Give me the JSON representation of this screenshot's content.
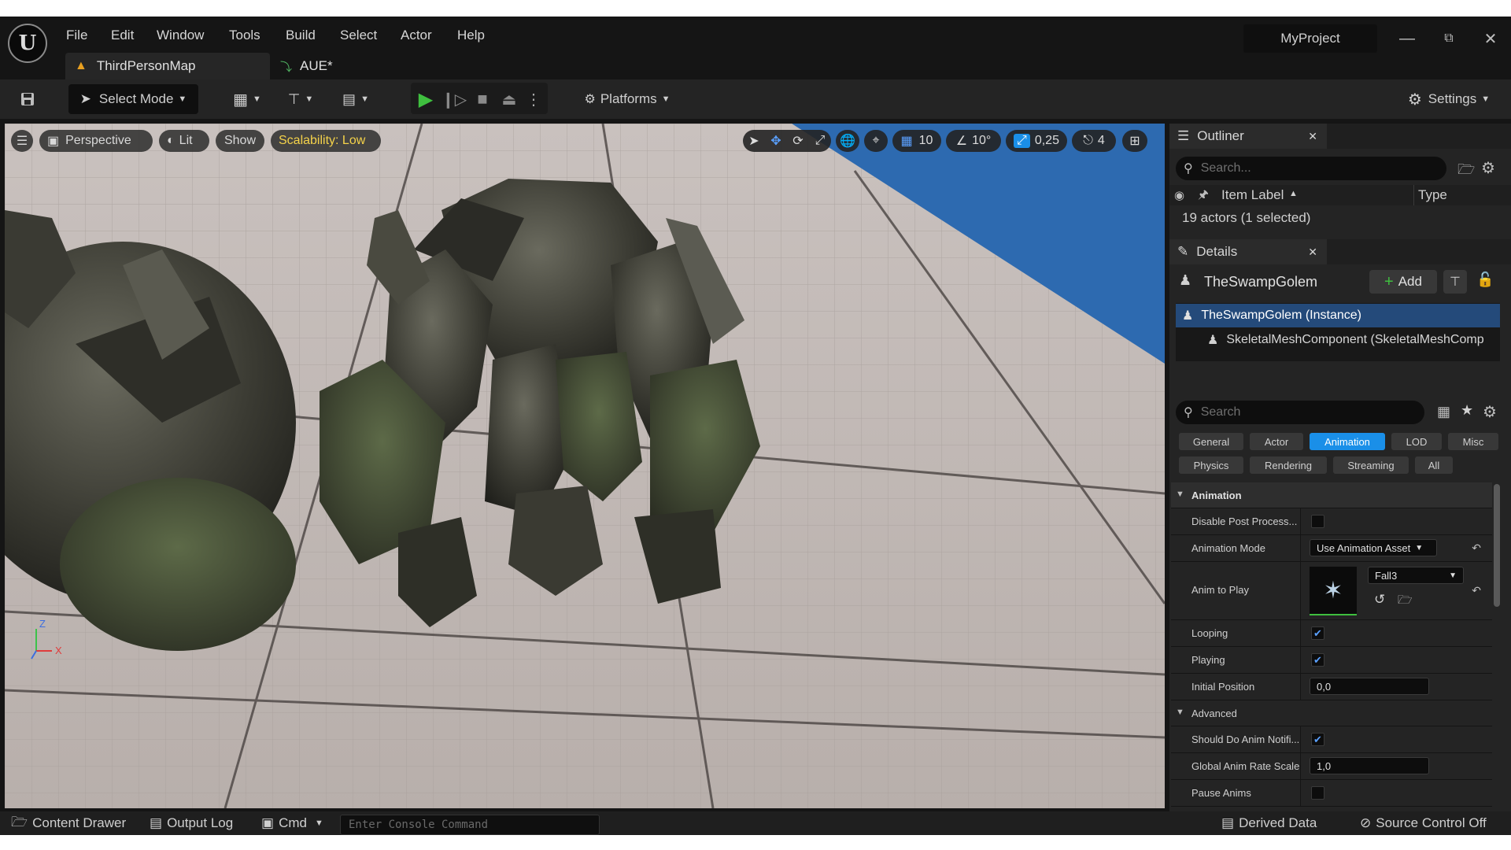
{
  "app": {
    "project": "MyProject"
  },
  "menu": [
    "File",
    "Edit",
    "Window",
    "Tools",
    "Build",
    "Select",
    "Actor",
    "Help"
  ],
  "tabs": {
    "map": "ThirdPersonMap",
    "asset": "AUE*"
  },
  "toolbar": {
    "select_mode": "Select Mode",
    "platforms": "Platforms",
    "settings": "Settings"
  },
  "viewport": {
    "perspective": "Perspective",
    "lit": "Lit",
    "show": "Show",
    "scalability": "Scalability: Low",
    "grid_snap": "10",
    "rotation_snap": "10°",
    "scale_snap": "0,25",
    "camera_speed": "4",
    "axis": {
      "z": "Z",
      "x": "X"
    }
  },
  "outliner": {
    "title": "Outliner",
    "search_placeholder": "Search...",
    "col_label": "Item Label",
    "col_type": "Type",
    "count": "19 actors (1 selected)"
  },
  "details": {
    "title": "Details",
    "actor_name": "TheSwampGolem",
    "add_label": "Add",
    "instance": "TheSwampGolem (Instance)",
    "component": "SkeletalMeshComponent (SkeletalMeshComp",
    "search_placeholder": "Search",
    "categories_row1": [
      "General",
      "Actor",
      "Animation",
      "LOD",
      "Misc"
    ],
    "categories_row2": [
      "Physics",
      "Rendering",
      "Streaming",
      "All"
    ],
    "active_category": "Animation",
    "section_animation": "Animation",
    "section_advanced": "Advanced",
    "props": {
      "disable_post_process": {
        "label": "Disable Post Process...",
        "checked": false
      },
      "animation_mode": {
        "label": "Animation Mode",
        "value": "Use Animation Asset"
      },
      "anim_to_play": {
        "label": "Anim to Play",
        "value": "Fall3"
      },
      "looping": {
        "label": "Looping",
        "checked": true
      },
      "playing": {
        "label": "Playing",
        "checked": true
      },
      "initial_position": {
        "label": "Initial Position",
        "value": "0,0"
      },
      "should_do_anim_notifies": {
        "label": "Should Do Anim Notifi...",
        "checked": true
      },
      "global_anim_rate_scale": {
        "label": "Global Anim Rate Scale",
        "value": "1,0"
      },
      "pause_anims": {
        "label": "Pause Anims",
        "checked": false
      }
    }
  },
  "statusbar": {
    "content_drawer": "Content Drawer",
    "output_log": "Output Log",
    "cmd": "Cmd",
    "console_placeholder": "Enter Console Command",
    "derived_data": "Derived Data",
    "source_control": "Source Control Off"
  },
  "colors": {
    "accent": "#1a8fe8",
    "selected_row": "#244a7a",
    "play": "#3fbf3f",
    "scalability": "#f4d24a"
  }
}
